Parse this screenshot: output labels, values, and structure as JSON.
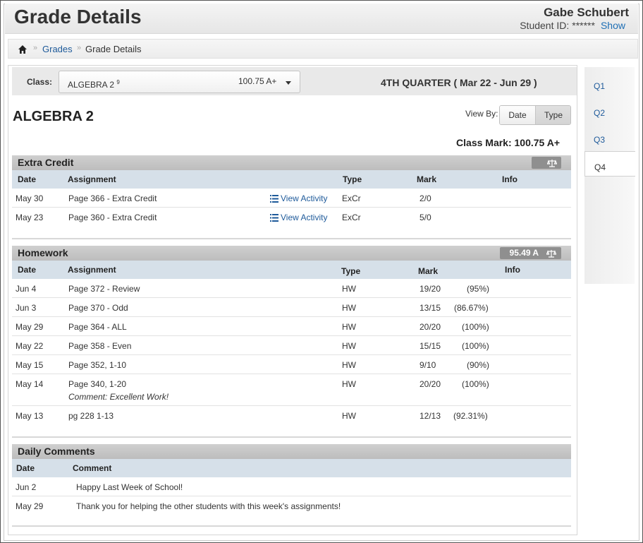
{
  "header": {
    "title": "Grade Details",
    "student_name": "Gabe Schubert",
    "student_id_label": "Student ID:",
    "student_id_value": "******",
    "show_link": "Show"
  },
  "breadcrumb": {
    "home_icon": "home-icon",
    "separator": "»",
    "items": [
      "Grades",
      "Grade Details"
    ]
  },
  "class_bar": {
    "label": "Class:",
    "selected_class": "ALGEBRA 2",
    "selected_class_sup": "9",
    "selected_mark": "100.75 A+",
    "quarter": "4TH QUARTER ( Mar 22 - Jun 29 )"
  },
  "course": {
    "title": "ALGEBRA 2",
    "view_by_label": "View By:",
    "view_by_options": [
      "Date",
      "Type"
    ],
    "view_by_selected": "Type",
    "class_mark": "Class Mark: 100.75 A+"
  },
  "extra_credit": {
    "title": "Extra Credit",
    "badge": "",
    "columns": [
      "Date",
      "Assignment",
      "Type",
      "Mark",
      "Info"
    ],
    "rows": [
      {
        "date": "May 30",
        "assignment": "Page 366 - Extra Credit",
        "activity": "View Activity",
        "type": "ExCr",
        "mark": "2/0",
        "pct": ""
      },
      {
        "date": "May 23",
        "assignment": "Page 360 - Extra Credit",
        "activity": "View Activity",
        "type": "ExCr",
        "mark": "5/0",
        "pct": ""
      }
    ]
  },
  "homework": {
    "title": "Homework",
    "badge": "95.49 A",
    "columns": [
      "Date",
      "Assignment",
      "Type",
      "Mark",
      "Info"
    ],
    "rows": [
      {
        "date": "Jun 4",
        "assignment": "Page 372 - Review",
        "type": "HW",
        "mark": "19/20",
        "pct": "(95%)"
      },
      {
        "date": "Jun 3",
        "assignment": "Page 370 - Odd",
        "type": "HW",
        "mark": "13/15",
        "pct": "(86.67%)"
      },
      {
        "date": "May 29",
        "assignment": "Page 364 - ALL",
        "type": "HW",
        "mark": "20/20",
        "pct": "(100%)"
      },
      {
        "date": "May 22",
        "assignment": "Page 358 - Even",
        "type": "HW",
        "mark": "15/15",
        "pct": "(100%)"
      },
      {
        "date": "May 15",
        "assignment": "Page 352, 1-10",
        "type": "HW",
        "mark": "9/10",
        "pct": "(90%)"
      },
      {
        "date": "May 14",
        "assignment": "Page 340, 1-20",
        "comment": "Comment: Excellent Work!",
        "type": "HW",
        "mark": "20/20",
        "pct": "(100%)"
      },
      {
        "date": "May 13",
        "assignment": "pg 228 1-13",
        "type": "HW",
        "mark": "12/13",
        "pct": "(92.31%)"
      }
    ]
  },
  "daily_comments": {
    "title": "Daily Comments",
    "columns": [
      "Date",
      "Comment"
    ],
    "rows": [
      {
        "date": "Jun 2",
        "comment": "Happy Last Week of School!"
      },
      {
        "date": "May 29",
        "comment": "Thank you for helping the other students with this week's assignments!"
      }
    ]
  },
  "quarter_tabs": [
    "Q1",
    "Q2",
    "Q3",
    "Q4"
  ],
  "quarter_tab_selected": "Q4",
  "colors": {
    "link": "#1e5a9a",
    "column_header_bg": "#d6e0e9",
    "section_header_bg": "#c6c6c6",
    "badge_bg": "#8f8f8f"
  }
}
